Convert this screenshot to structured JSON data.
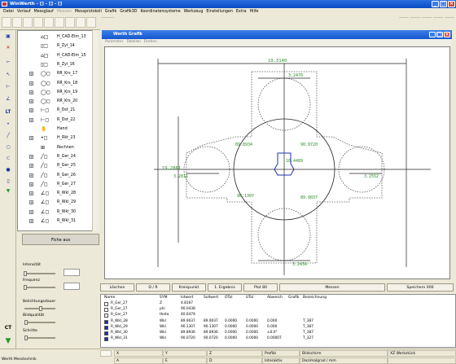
{
  "window": {
    "title": "WinWerth - [] - [] - []"
  },
  "menu": [
    "Datei",
    "Vorlauf",
    "Messglauf",
    "Messen",
    "Messprotokoll",
    "Grafik",
    "Grafik3D",
    "Koordinatensysteme",
    "Werkzeug",
    "Einstellungen",
    "Extra",
    "Hilfe"
  ],
  "menu_disabled": [
    3
  ],
  "toolbar": {
    "button_3d": "3D"
  },
  "tree": [
    {
      "label": "H_CAD-Elm_13",
      "icon": "cad-element-icon",
      "expand": false
    },
    {
      "label": "R_Zyl_14",
      "icon": "cylinder-icon",
      "expand": false
    },
    {
      "label": "H_CAD-Elm_15",
      "icon": "cad-element-icon",
      "expand": false
    },
    {
      "label": "R_Zyl_16",
      "icon": "cylinder-icon",
      "expand": false
    },
    {
      "label": "RR_Krs_17",
      "icon": "circle-icon",
      "expand": true
    },
    {
      "label": "RR_Krs_18",
      "icon": "circle-icon",
      "expand": true
    },
    {
      "label": "RR_Krs_19",
      "icon": "circle-icon",
      "expand": true
    },
    {
      "label": "RR_Krs_20",
      "icon": "circle-icon",
      "expand": true
    },
    {
      "label": "R_Dst_21",
      "icon": "distance-icon",
      "expand": true
    },
    {
      "label": "R_Dst_22",
      "icon": "distance-icon",
      "expand": true
    },
    {
      "label": "Hand",
      "icon": "hand-icon",
      "expand": false
    },
    {
      "label": "H_Rkt_23",
      "icon": "point-icon",
      "expand": true
    },
    {
      "label": "Rechnen",
      "icon": "calculate-icon",
      "expand": false
    },
    {
      "label": "R_Ger_24",
      "icon": "line-icon",
      "expand": true
    },
    {
      "label": "R_Ger_25",
      "icon": "line-icon",
      "expand": true
    },
    {
      "label": "R_Ger_26",
      "icon": "line-icon",
      "expand": true
    },
    {
      "label": "R_Ger_27",
      "icon": "line-icon",
      "expand": true
    },
    {
      "label": "R_Wkl_28",
      "icon": "angle-icon",
      "expand": true
    },
    {
      "label": "R_Wkl_29",
      "icon": "angle-icon",
      "expand": true
    },
    {
      "label": "R_Wkl_30",
      "icon": "angle-icon",
      "expand": true
    },
    {
      "label": "R_Wkl_31",
      "icon": "angle-icon",
      "expand": true
    }
  ],
  "left_panel": {
    "measure_button": "Fiche aus",
    "intensity_label": "Intensität",
    "frequency_label": "Frequenz",
    "exposure_label": "Belichtungsdauer",
    "image_quality_label": "Bildqualität",
    "step_label": "Schritte",
    "ct_label": "CT"
  },
  "graphic_window": {
    "title": "Werth Grafik",
    "sub_menu": [
      "Parameter",
      "Tabellen",
      "Drehen"
    ],
    "dimensions": {
      "top_width": "19.3140",
      "top_small": "3.2476",
      "left_height": "19.2861",
      "left_small": "3.2811",
      "right_small": "3.2552",
      "bottom_small": "3.2434",
      "angle_tl": "89.8934",
      "angle_tr": "90.0720",
      "angle_bl": "90.1307",
      "angle_br": "89.9037",
      "center_dist": "10.4489"
    }
  },
  "buttons_row": [
    "Löschen",
    "D / R",
    "Kreispunkt",
    "1. Ergebnis",
    "Plot 80",
    "Messen",
    "Speichern 000"
  ],
  "results": {
    "headers": [
      "Name",
      "SYM",
      "Istwert",
      "Sollwert",
      "OTol",
      "UTol",
      "Abweich",
      "Grafik",
      "Bezeichnung"
    ],
    "rows": [
      {
        "name": "R_Ger_27",
        "color": "#ffffff",
        "sym": "Z",
        "ist": "4.8167",
        "soll": "",
        "otol": "",
        "utol": "",
        "abw": "",
        "grafik": "",
        "bez": ""
      },
      {
        "name": "R_Ger_27",
        "color": "#ffffff",
        "sym": "phi",
        "ist": "90.0438",
        "soll": "",
        "otol": "",
        "utol": "",
        "abw": "",
        "grafik": "",
        "bez": ""
      },
      {
        "name": "R_Ger_27",
        "color": "#ffffff",
        "sym": "theta",
        "ist": "40.6479",
        "soll": "",
        "otol": "",
        "utol": "",
        "abw": "",
        "grafik": "",
        "bez": ""
      },
      {
        "name": "R_Wkl_28",
        "color": "#1e2fb0",
        "sym": "Wkl",
        "ist": "89.9037",
        "soll": "89.9037",
        "otol": "0.0000",
        "utol": "0.0000",
        "abw": "0.000",
        "grafik": "",
        "bez": "T_387"
      },
      {
        "name": "R_Wkl_29",
        "color": "#1e2fb0",
        "sym": "Wkl",
        "ist": "90.1307",
        "soll": "90.1307",
        "otol": "0.0000",
        "utol": "0.0000",
        "abw": "0.000",
        "grafik": "",
        "bez": "T_387"
      },
      {
        "name": "R_Wkl_30",
        "color": "#1e2fb0",
        "sym": "Wkl",
        "ist": "89.8936",
        "soll": "89.8936",
        "otol": "0.0000",
        "utol": "0.0000",
        "abw": "±0.0°",
        "grafik": "",
        "bez": "T_387"
      },
      {
        "name": "R_Wkl_31",
        "color": "#1e2fb0",
        "sym": "Wkl",
        "ist": "90.0720",
        "soll": "90.0720",
        "otol": "0.0000",
        "utol": "0.0000",
        "abw": "0.00007",
        "grafik": "",
        "bez": "T_327"
      }
    ]
  },
  "status": {
    "company": "Werth Messtechnik",
    "x_label": "X",
    "y_label": "Y",
    "z_label": "Z",
    "a_label": "A",
    "e_label": "E",
    "d_label": "D",
    "profile": "Profibi",
    "interact": "Interaktiv",
    "image": "Bildschirm",
    "decimal": "Dezimalgrad / mm",
    "workpiece": "XZ Werkstück"
  }
}
